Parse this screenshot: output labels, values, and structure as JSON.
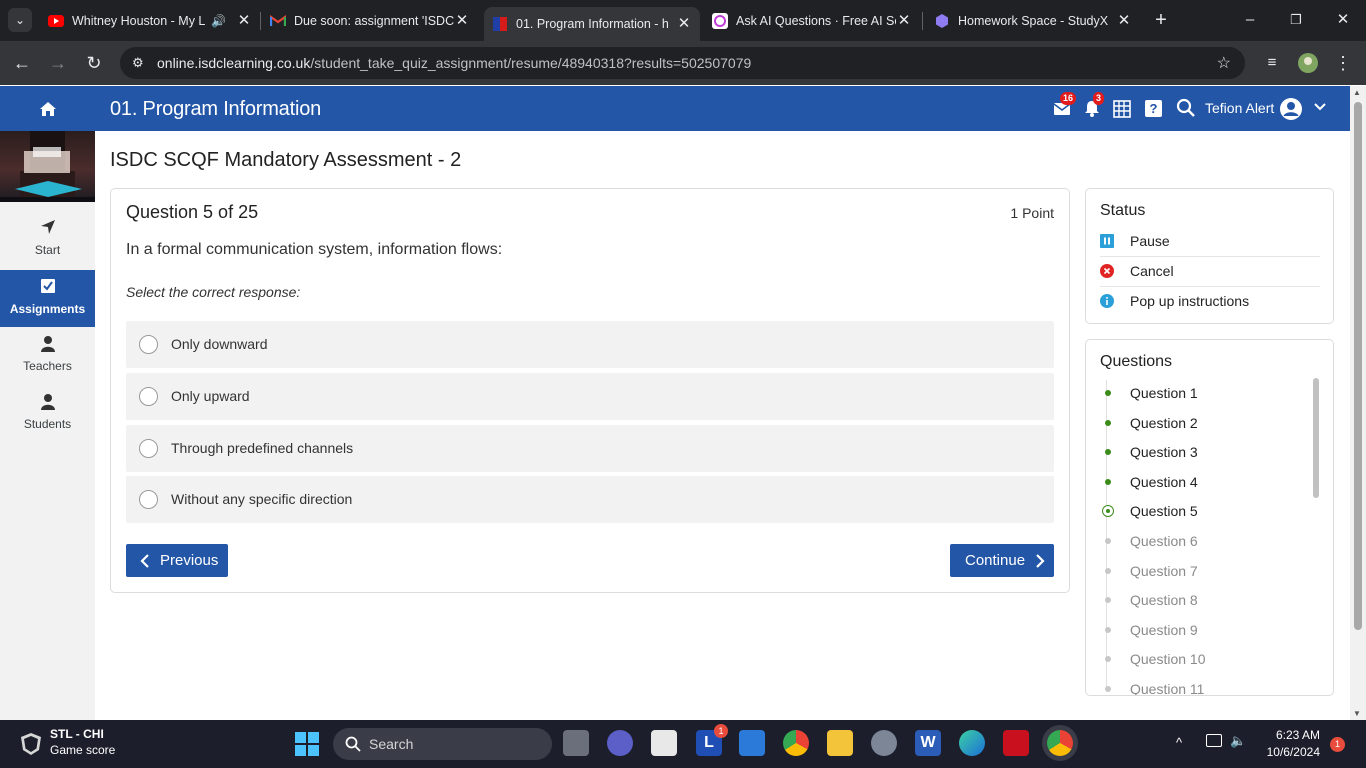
{
  "browser": {
    "tabs": [
      {
        "title": "Whitney Houston - My L",
        "active": false
      },
      {
        "title": "Due soon: assignment 'ISDC",
        "active": false
      },
      {
        "title": "01. Program Information - h",
        "active": true
      },
      {
        "title": "Ask AI Questions · Free AI Se",
        "active": false
      },
      {
        "title": "Homework Space - StudyX",
        "active": false
      }
    ],
    "url_host": "online.isdclearning.co.uk",
    "url_path": "/student_take_quiz_assignment/resume/48940318?results=502507079"
  },
  "header": {
    "title": "01. Program Information",
    "mail_count": "16",
    "notif_count": "3",
    "help": "?",
    "user_name": "Tefion Alert"
  },
  "sidebar": {
    "items": [
      {
        "label": "Start"
      },
      {
        "label": "Assignments"
      },
      {
        "label": "Teachers"
      },
      {
        "label": "Students"
      }
    ]
  },
  "main": {
    "assessment_title": "ISDC SCQF Mandatory Assessment - 2",
    "question_number": "Question 5 of 25",
    "points": "1 Point",
    "question_text": "In a formal communication system, information flows:",
    "instruction": "Select the correct response:",
    "options": [
      {
        "label": "Only downward"
      },
      {
        "label": "Only upward"
      },
      {
        "label": "Through predefined channels"
      },
      {
        "label": "Without any specific direction"
      }
    ],
    "previous_label": "Previous",
    "continue_label": "Continue"
  },
  "status_panel": {
    "title": "Status",
    "items": [
      {
        "label": "Pause",
        "icon": "pause-icon",
        "color": "#2a9fd8"
      },
      {
        "label": "Cancel",
        "icon": "cancel-icon",
        "color": "#e02424"
      },
      {
        "label": "Pop up instructions",
        "icon": "info-icon",
        "color": "#2a9fd8"
      }
    ]
  },
  "questions_panel": {
    "title": "Questions",
    "items": [
      {
        "label": "Question 1",
        "state": "done"
      },
      {
        "label": "Question 2",
        "state": "done"
      },
      {
        "label": "Question 3",
        "state": "done"
      },
      {
        "label": "Question 4",
        "state": "done"
      },
      {
        "label": "Question 5",
        "state": "current"
      },
      {
        "label": "Question 6",
        "state": "pending"
      },
      {
        "label": "Question 7",
        "state": "pending"
      },
      {
        "label": "Question 8",
        "state": "pending"
      },
      {
        "label": "Question 9",
        "state": "pending"
      },
      {
        "label": "Question 10",
        "state": "pending"
      },
      {
        "label": "Question 11",
        "state": "pending"
      }
    ]
  },
  "taskbar": {
    "weather_title": "STL - CHI",
    "weather_sub": "Game score",
    "search_placeholder": "Search",
    "time": "6:23 AM",
    "date": "10/6/2024",
    "notif_count": "1",
    "mail_badge": "1"
  },
  "colors": {
    "header_blue": "#2356a7",
    "done_green": "#3a8b1a"
  }
}
